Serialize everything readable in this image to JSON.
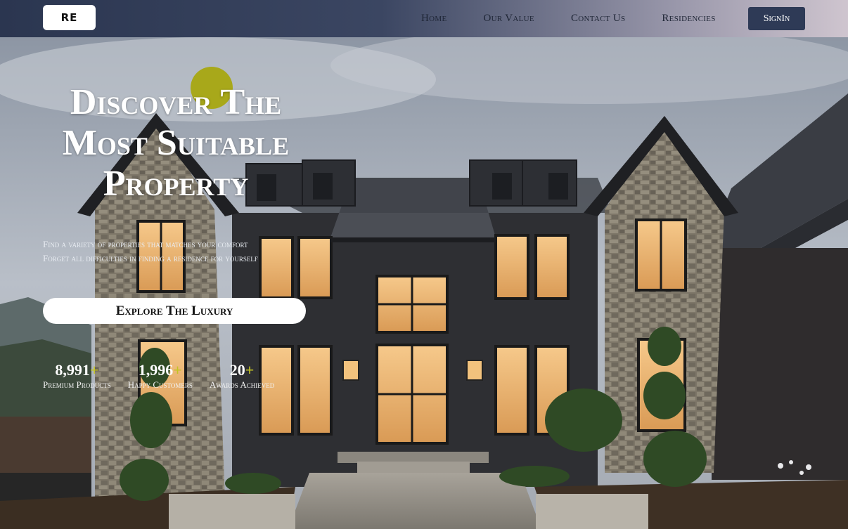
{
  "navbar": {
    "logo_text": "RE",
    "links": [
      "Home",
      "Our Value",
      "Contact Us",
      "Residencies"
    ],
    "signin_label": "SignIn"
  },
  "hero": {
    "headline_lines": [
      "Discover The",
      "Most Suitable",
      "Property"
    ],
    "subtext_lines": [
      "Find a variety of properties that matches your comfort",
      "Forget all difficulties in finding a residence for yourself"
    ],
    "cta_label": "Explore The Luxury",
    "stats": [
      {
        "value": "8,991",
        "suffix": "+",
        "label": "Premium Products"
      },
      {
        "value": "1,996",
        "suffix": "+",
        "label": "Happy Customers"
      },
      {
        "value": "20",
        "suffix": "+",
        "label": "Awards Achieved"
      }
    ]
  },
  "colors": {
    "accent": "#a8a81a",
    "nav_button": "#2e3a56"
  }
}
